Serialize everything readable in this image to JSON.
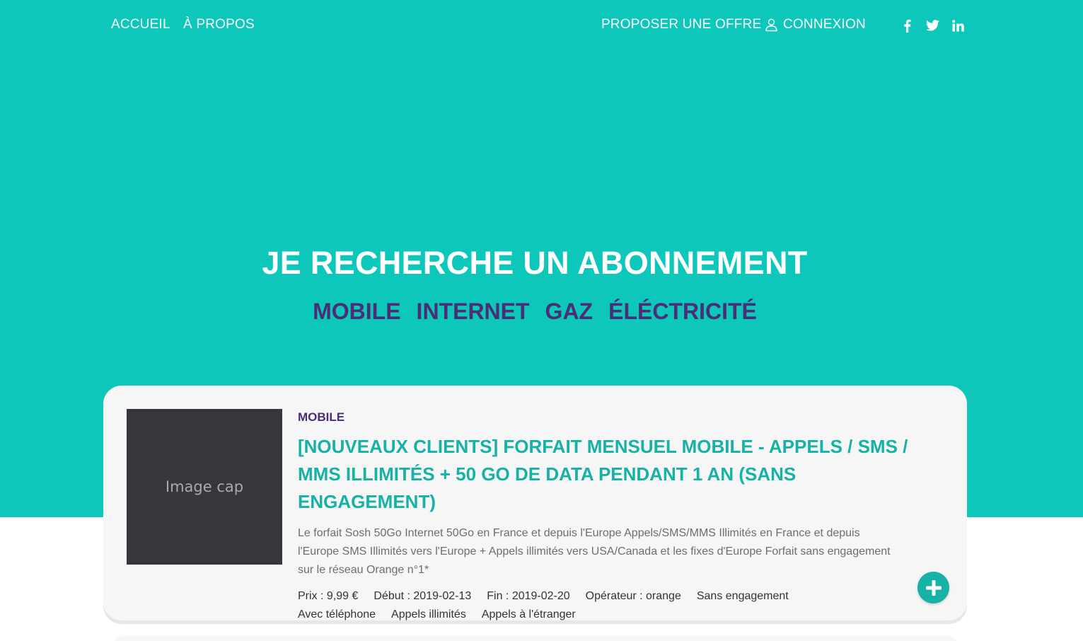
{
  "nav": {
    "home": "ACCUEIL",
    "about": "À PROPOS",
    "propose": "PROPOSER UNE OFFRE",
    "login": "CONNEXION",
    "social_icons": [
      "facebook-icon",
      "twitter-icon",
      "linkedin-icon"
    ]
  },
  "hero": {
    "title": "JE RECHERCHE UN ABONNEMENT",
    "categories": [
      "MOBILE",
      "INTERNET",
      "GAZ",
      "ÉLÉCTRICITÉ"
    ]
  },
  "offer": {
    "image_placeholder": "Image cap",
    "category": "MOBILE",
    "title": "[NOUVEAUX CLIENTS] FORFAIT MENSUEL MOBILE - APPELS / SMS / MMS ILLIMITÉS + 50 GO DE DATA PENDANT 1 AN (SANS ENGAGEMENT)",
    "description": "Le forfait Sosh 50Go Internet 50Go en France et depuis l'Europe Appels/SMS/MMS Illimités en France et depuis l'Europe SMS Illimités vers l'Europe + Appels illimités vers USA/Canada et les fixes d'Europe Forfait sans engagement sur le réseau Orange n°1*",
    "details": {
      "price": "Prix : 9,99 €",
      "start": "Début : 2019-02-13",
      "end": "Fin : 2019-02-20",
      "operator": "Opérateur : orange",
      "commitment": "Sans engagement",
      "phone": "Avec téléphone",
      "calls": "Appels illimités",
      "abroad": "Appels à l'étranger"
    }
  },
  "colors": {
    "hero_bg": "#0dc8ba",
    "accent": "#16b2a6",
    "category_purple": "#4a2d76",
    "card_bg": "#f6f6f6"
  }
}
